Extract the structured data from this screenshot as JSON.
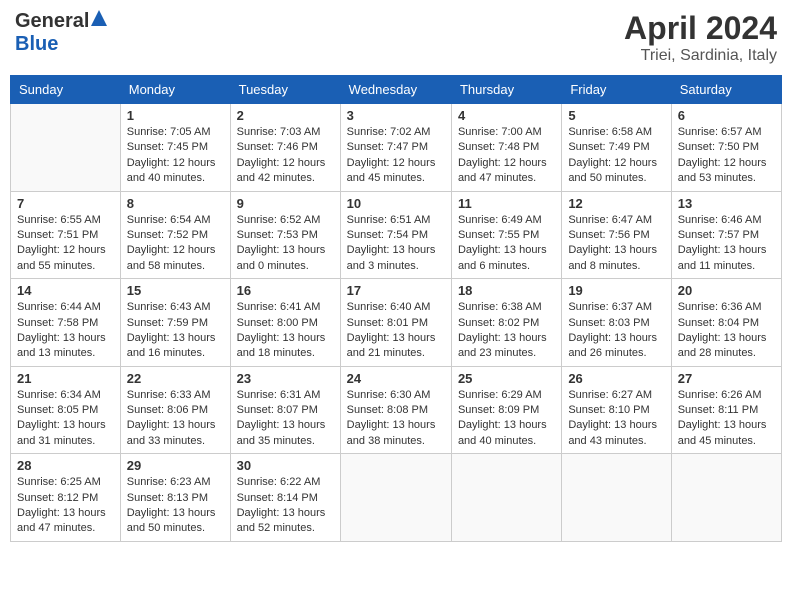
{
  "header": {
    "logo_general": "General",
    "logo_blue": "Blue",
    "month_title": "April 2024",
    "location": "Triei, Sardinia, Italy"
  },
  "days_of_week": [
    "Sunday",
    "Monday",
    "Tuesday",
    "Wednesday",
    "Thursday",
    "Friday",
    "Saturday"
  ],
  "weeks": [
    [
      {
        "day": "",
        "info": ""
      },
      {
        "day": "1",
        "info": "Sunrise: 7:05 AM\nSunset: 7:45 PM\nDaylight: 12 hours\nand 40 minutes."
      },
      {
        "day": "2",
        "info": "Sunrise: 7:03 AM\nSunset: 7:46 PM\nDaylight: 12 hours\nand 42 minutes."
      },
      {
        "day": "3",
        "info": "Sunrise: 7:02 AM\nSunset: 7:47 PM\nDaylight: 12 hours\nand 45 minutes."
      },
      {
        "day": "4",
        "info": "Sunrise: 7:00 AM\nSunset: 7:48 PM\nDaylight: 12 hours\nand 47 minutes."
      },
      {
        "day": "5",
        "info": "Sunrise: 6:58 AM\nSunset: 7:49 PM\nDaylight: 12 hours\nand 50 minutes."
      },
      {
        "day": "6",
        "info": "Sunrise: 6:57 AM\nSunset: 7:50 PM\nDaylight: 12 hours\nand 53 minutes."
      }
    ],
    [
      {
        "day": "7",
        "info": "Sunrise: 6:55 AM\nSunset: 7:51 PM\nDaylight: 12 hours\nand 55 minutes."
      },
      {
        "day": "8",
        "info": "Sunrise: 6:54 AM\nSunset: 7:52 PM\nDaylight: 12 hours\nand 58 minutes."
      },
      {
        "day": "9",
        "info": "Sunrise: 6:52 AM\nSunset: 7:53 PM\nDaylight: 13 hours\nand 0 minutes."
      },
      {
        "day": "10",
        "info": "Sunrise: 6:51 AM\nSunset: 7:54 PM\nDaylight: 13 hours\nand 3 minutes."
      },
      {
        "day": "11",
        "info": "Sunrise: 6:49 AM\nSunset: 7:55 PM\nDaylight: 13 hours\nand 6 minutes."
      },
      {
        "day": "12",
        "info": "Sunrise: 6:47 AM\nSunset: 7:56 PM\nDaylight: 13 hours\nand 8 minutes."
      },
      {
        "day": "13",
        "info": "Sunrise: 6:46 AM\nSunset: 7:57 PM\nDaylight: 13 hours\nand 11 minutes."
      }
    ],
    [
      {
        "day": "14",
        "info": "Sunrise: 6:44 AM\nSunset: 7:58 PM\nDaylight: 13 hours\nand 13 minutes."
      },
      {
        "day": "15",
        "info": "Sunrise: 6:43 AM\nSunset: 7:59 PM\nDaylight: 13 hours\nand 16 minutes."
      },
      {
        "day": "16",
        "info": "Sunrise: 6:41 AM\nSunset: 8:00 PM\nDaylight: 13 hours\nand 18 minutes."
      },
      {
        "day": "17",
        "info": "Sunrise: 6:40 AM\nSunset: 8:01 PM\nDaylight: 13 hours\nand 21 minutes."
      },
      {
        "day": "18",
        "info": "Sunrise: 6:38 AM\nSunset: 8:02 PM\nDaylight: 13 hours\nand 23 minutes."
      },
      {
        "day": "19",
        "info": "Sunrise: 6:37 AM\nSunset: 8:03 PM\nDaylight: 13 hours\nand 26 minutes."
      },
      {
        "day": "20",
        "info": "Sunrise: 6:36 AM\nSunset: 8:04 PM\nDaylight: 13 hours\nand 28 minutes."
      }
    ],
    [
      {
        "day": "21",
        "info": "Sunrise: 6:34 AM\nSunset: 8:05 PM\nDaylight: 13 hours\nand 31 minutes."
      },
      {
        "day": "22",
        "info": "Sunrise: 6:33 AM\nSunset: 8:06 PM\nDaylight: 13 hours\nand 33 minutes."
      },
      {
        "day": "23",
        "info": "Sunrise: 6:31 AM\nSunset: 8:07 PM\nDaylight: 13 hours\nand 35 minutes."
      },
      {
        "day": "24",
        "info": "Sunrise: 6:30 AM\nSunset: 8:08 PM\nDaylight: 13 hours\nand 38 minutes."
      },
      {
        "day": "25",
        "info": "Sunrise: 6:29 AM\nSunset: 8:09 PM\nDaylight: 13 hours\nand 40 minutes."
      },
      {
        "day": "26",
        "info": "Sunrise: 6:27 AM\nSunset: 8:10 PM\nDaylight: 13 hours\nand 43 minutes."
      },
      {
        "day": "27",
        "info": "Sunrise: 6:26 AM\nSunset: 8:11 PM\nDaylight: 13 hours\nand 45 minutes."
      }
    ],
    [
      {
        "day": "28",
        "info": "Sunrise: 6:25 AM\nSunset: 8:12 PM\nDaylight: 13 hours\nand 47 minutes."
      },
      {
        "day": "29",
        "info": "Sunrise: 6:23 AM\nSunset: 8:13 PM\nDaylight: 13 hours\nand 50 minutes."
      },
      {
        "day": "30",
        "info": "Sunrise: 6:22 AM\nSunset: 8:14 PM\nDaylight: 13 hours\nand 52 minutes."
      },
      {
        "day": "",
        "info": ""
      },
      {
        "day": "",
        "info": ""
      },
      {
        "day": "",
        "info": ""
      },
      {
        "day": "",
        "info": ""
      }
    ]
  ]
}
